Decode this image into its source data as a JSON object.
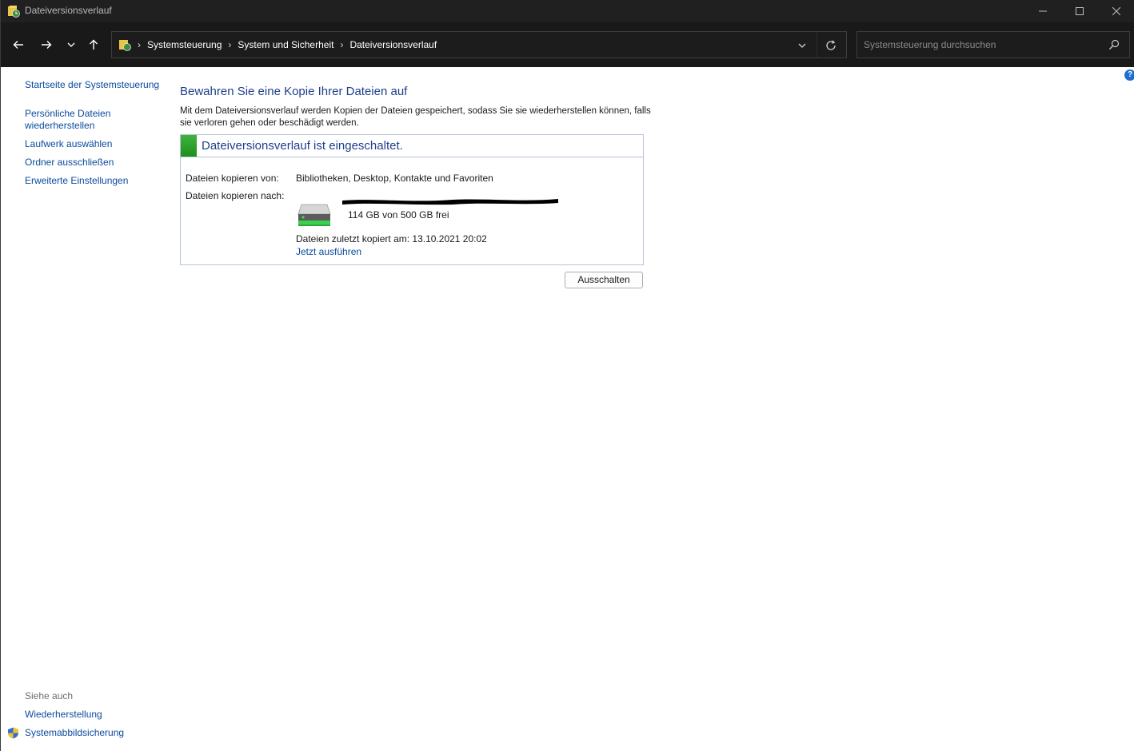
{
  "window": {
    "title": "Dateiversionsverlauf"
  },
  "navbar": {
    "breadcrumbs": [
      "Systemsteuerung",
      "System und Sicherheit",
      "Dateiversionsverlauf"
    ],
    "search_placeholder": "Systemsteuerung durchsuchen"
  },
  "sidebar": {
    "links": [
      {
        "label": "Startseite der Systemsteuerung"
      },
      {
        "label": "Persönliche Dateien wiederherstellen"
      },
      {
        "label": "Laufwerk auswählen"
      },
      {
        "label": "Ordner ausschließen"
      },
      {
        "label": "Erweiterte Einstellungen"
      }
    ],
    "see_also_heading": "Siehe auch",
    "see_also": [
      {
        "label": "Wiederherstellung"
      },
      {
        "label": "Systemabbildsicherung"
      }
    ]
  },
  "main": {
    "title": "Bewahren Sie eine Kopie Ihrer Dateien auf",
    "intro": "Mit dem Dateiversionsverlauf werden Kopien der Dateien gespeichert, sodass Sie sie wiederherstellen können, falls sie verloren gehen oder beschädigt werden.",
    "status_title": "Dateiversionsverlauf ist eingeschaltet.",
    "copy_from_label": "Dateien kopieren von:",
    "copy_from_value": "Bibliotheken, Desktop, Kontakte und Favoriten",
    "copy_to_label": "Dateien kopieren nach:",
    "drive_free": "114 GB von 500 GB frei",
    "last_copied": "Dateien zuletzt kopiert am: 13.10.2021 20:02",
    "run_now": "Jetzt ausführen",
    "turn_off_button": "Ausschalten"
  },
  "colors": {
    "link": "#0a4a9e",
    "heading": "#1e3f8a",
    "status_green": "#2ea82e",
    "titlebar": "#202020",
    "navbar": "#191919"
  }
}
